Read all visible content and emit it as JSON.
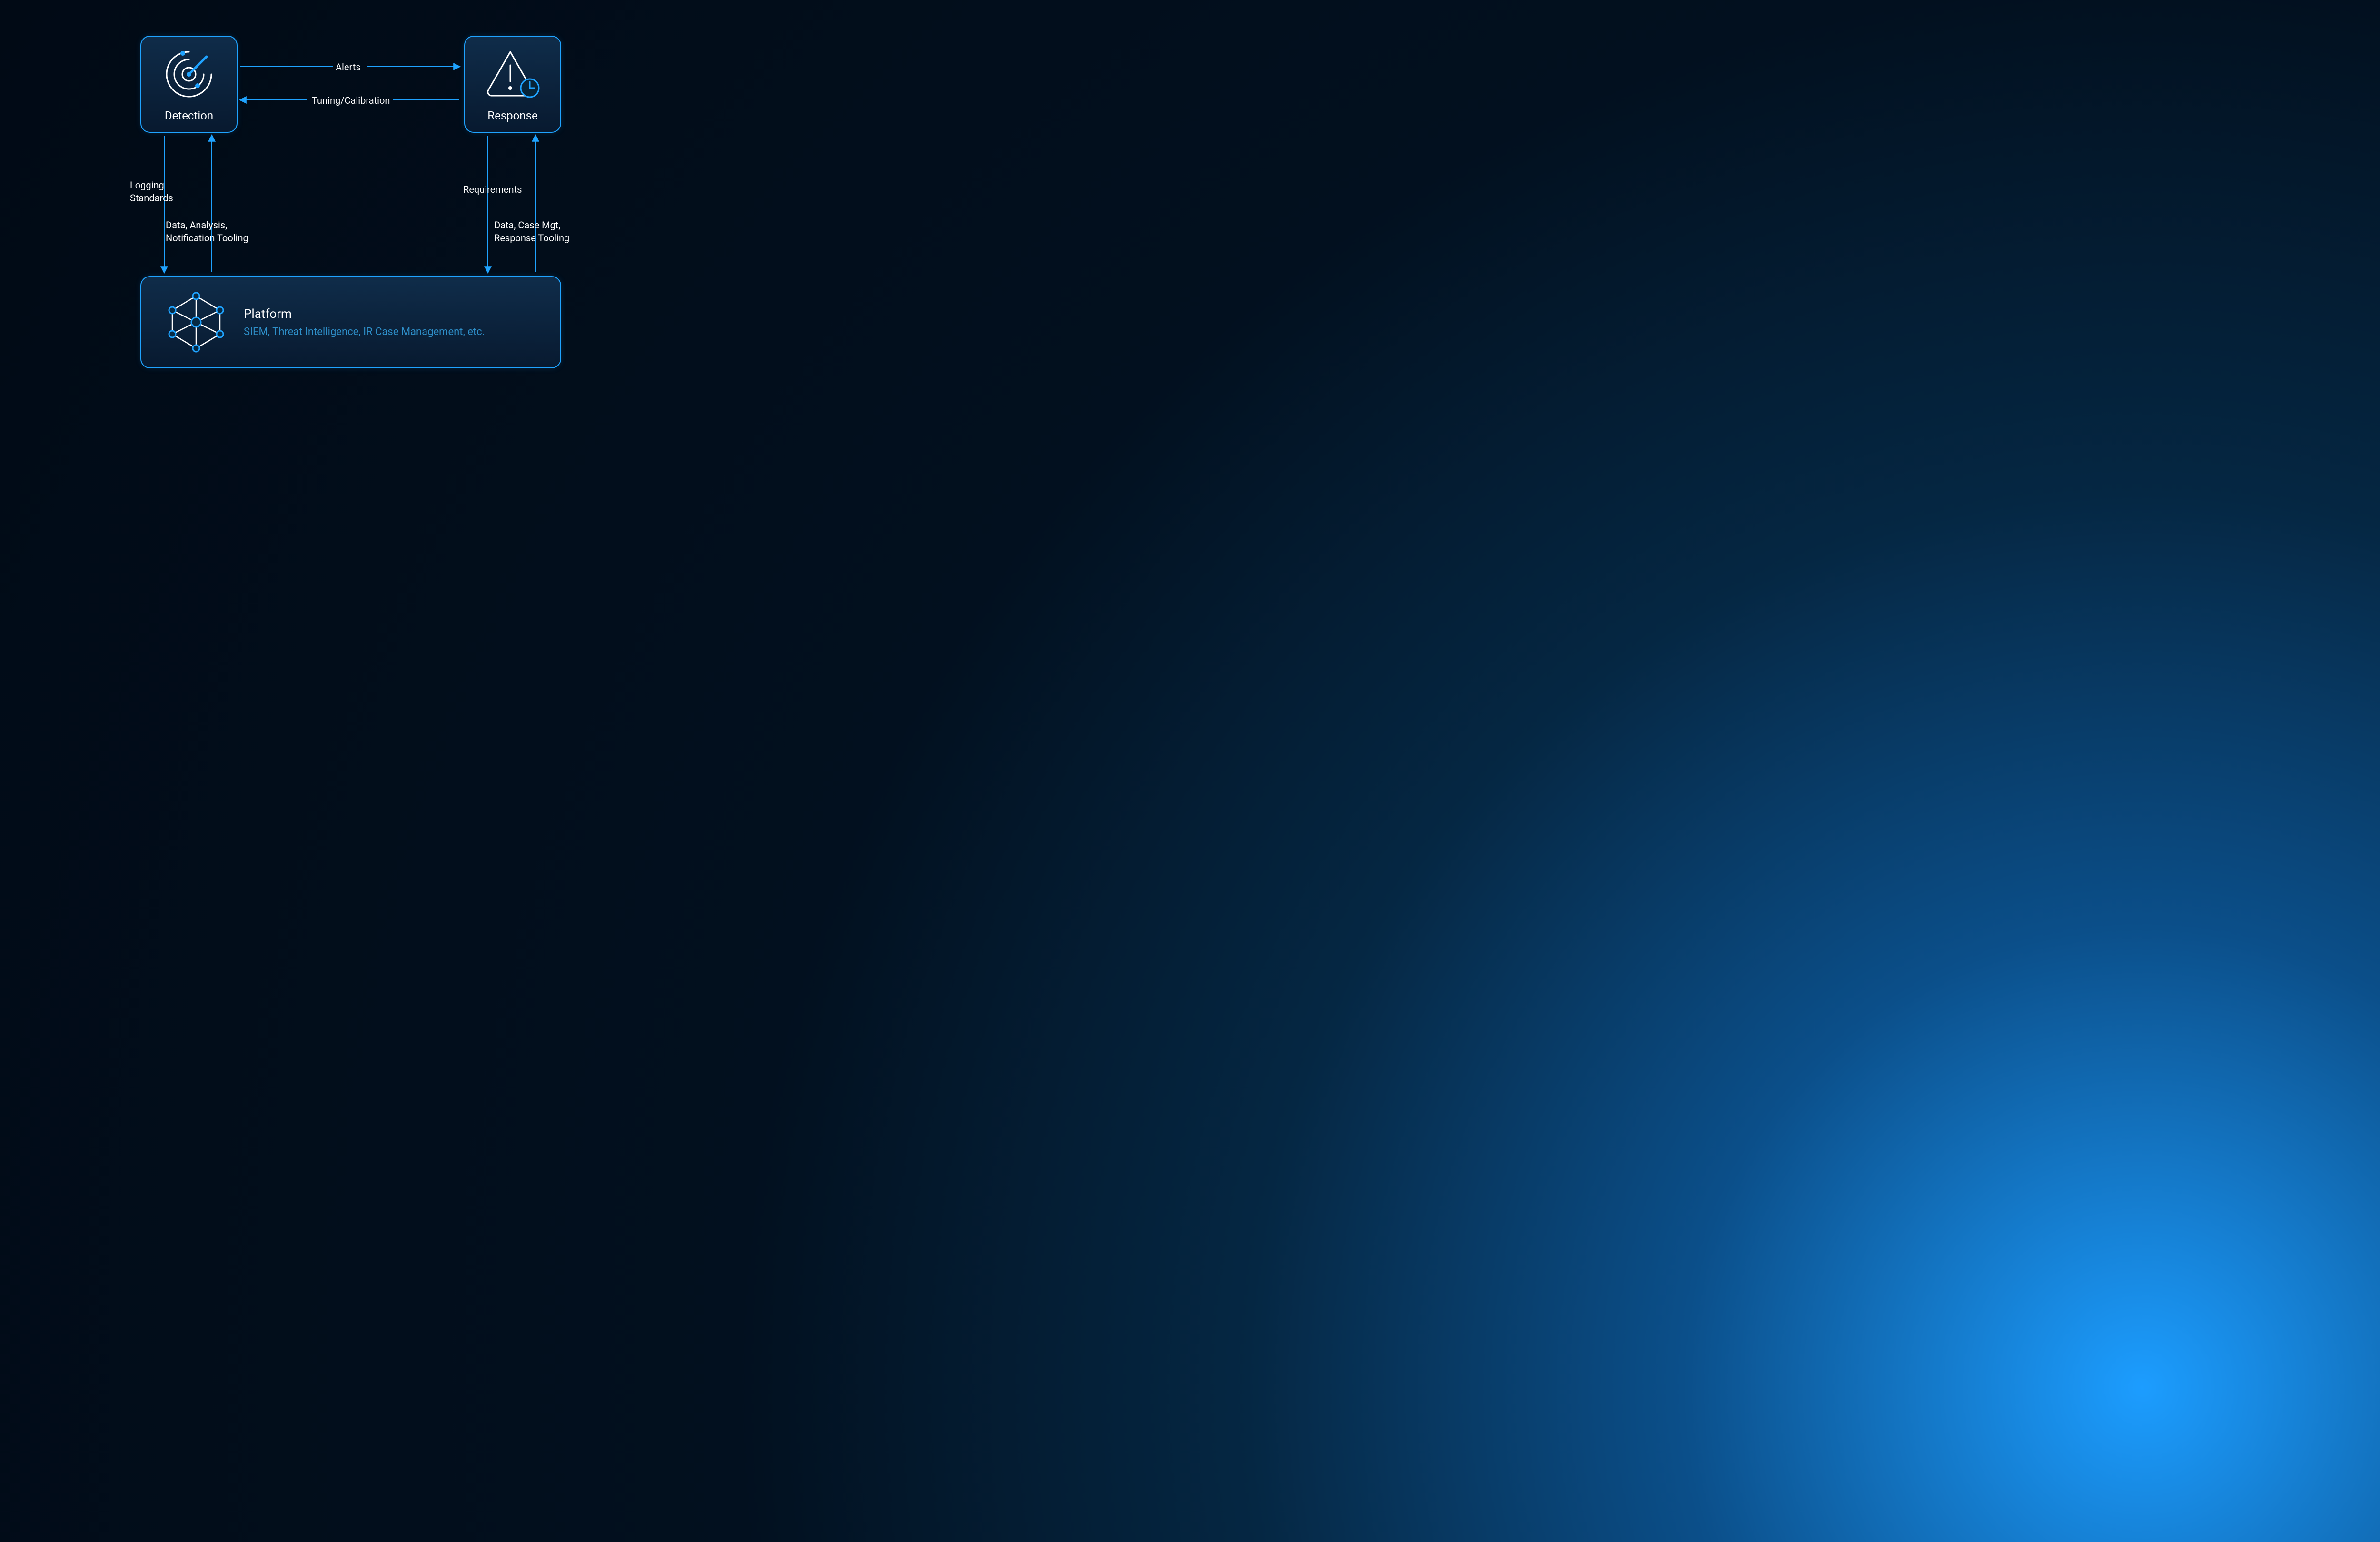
{
  "nodes": {
    "detection": {
      "label": "Detection"
    },
    "response": {
      "label": "Response"
    },
    "platform": {
      "title": "Platform",
      "subtitle": "SIEM, Threat Intelligence, IR Case Management, etc."
    }
  },
  "edges": {
    "alerts": "Alerts",
    "tuning": "Tuning/Calibration",
    "logging_l1": "Logging",
    "logging_l2": "Standards",
    "tooling_l1": "Data, Analysis,",
    "tooling_l2": "Notification Tooling",
    "requirements": "Requirements",
    "resp_tool_l1": "Data, Case Mgt,",
    "resp_tool_l2": "Response Tooling"
  },
  "colors": {
    "accent": "#1fa3ff",
    "white": "#ffffff",
    "muted": "#2e8fc9"
  }
}
